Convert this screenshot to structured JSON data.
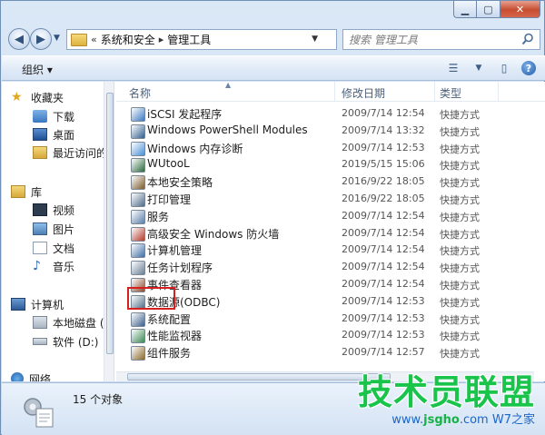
{
  "address": {
    "chevron": "«",
    "crumbs": [
      "系统和安全",
      "管理工具"
    ],
    "search_placeholder": "搜索 管理工具"
  },
  "toolbar": {
    "organize_label": "组织 ▾"
  },
  "nav_pane": {
    "favorites": {
      "label": "收藏夹",
      "items": [
        "下载",
        "桌面",
        "最近访问的"
      ]
    },
    "libraries": {
      "label": "库",
      "items": [
        "视频",
        "图片",
        "文档",
        "音乐"
      ]
    },
    "computer": {
      "label": "计算机",
      "items": [
        "本地磁盘 (C",
        "软件 (D:)"
      ]
    },
    "network": {
      "label": "网络"
    }
  },
  "columns": {
    "name": "名称",
    "modified": "修改日期",
    "type": "类型"
  },
  "files": [
    {
      "name": "iSCSI 发起程序",
      "modified": "2009/7/14 12:54",
      "type": "快捷方式"
    },
    {
      "name": "Windows PowerShell Modules",
      "modified": "2009/7/14 13:32",
      "type": "快捷方式"
    },
    {
      "name": "Windows 内存诊断",
      "modified": "2009/7/14 12:53",
      "type": "快捷方式"
    },
    {
      "name": "WUtooL",
      "modified": "2019/5/15 15:06",
      "type": "快捷方式"
    },
    {
      "name": "本地安全策略",
      "modified": "2016/9/22 18:05",
      "type": "快捷方式"
    },
    {
      "name": "打印管理",
      "modified": "2016/9/22 18:05",
      "type": "快捷方式"
    },
    {
      "name": "服务",
      "modified": "2009/7/14 12:54",
      "type": "快捷方式"
    },
    {
      "name": "高级安全 Windows 防火墙",
      "modified": "2009/7/14 12:54",
      "type": "快捷方式"
    },
    {
      "name": "计算机管理",
      "modified": "2009/7/14 12:54",
      "type": "快捷方式"
    },
    {
      "name": "任务计划程序",
      "modified": "2009/7/14 12:54",
      "type": "快捷方式"
    },
    {
      "name": "事件查看器",
      "modified": "2009/7/14 12:54",
      "type": "快捷方式"
    },
    {
      "name": "数据源(ODBC)",
      "modified": "2009/7/14 12:53",
      "type": "快捷方式"
    },
    {
      "name": "系统配置",
      "modified": "2009/7/14 12:53",
      "type": "快捷方式"
    },
    {
      "name": "性能监视器",
      "modified": "2009/7/14 12:53",
      "type": "快捷方式"
    },
    {
      "name": "组件服务",
      "modified": "2009/7/14 12:57",
      "type": "快捷方式"
    }
  ],
  "status": {
    "count": "15 个对象"
  },
  "watermark": {
    "title": "技术员联盟",
    "sub_prefix": "www.",
    "sub_brand": "jsgho",
    "sub_suffix": ".com",
    "tagline": "W7之家"
  }
}
